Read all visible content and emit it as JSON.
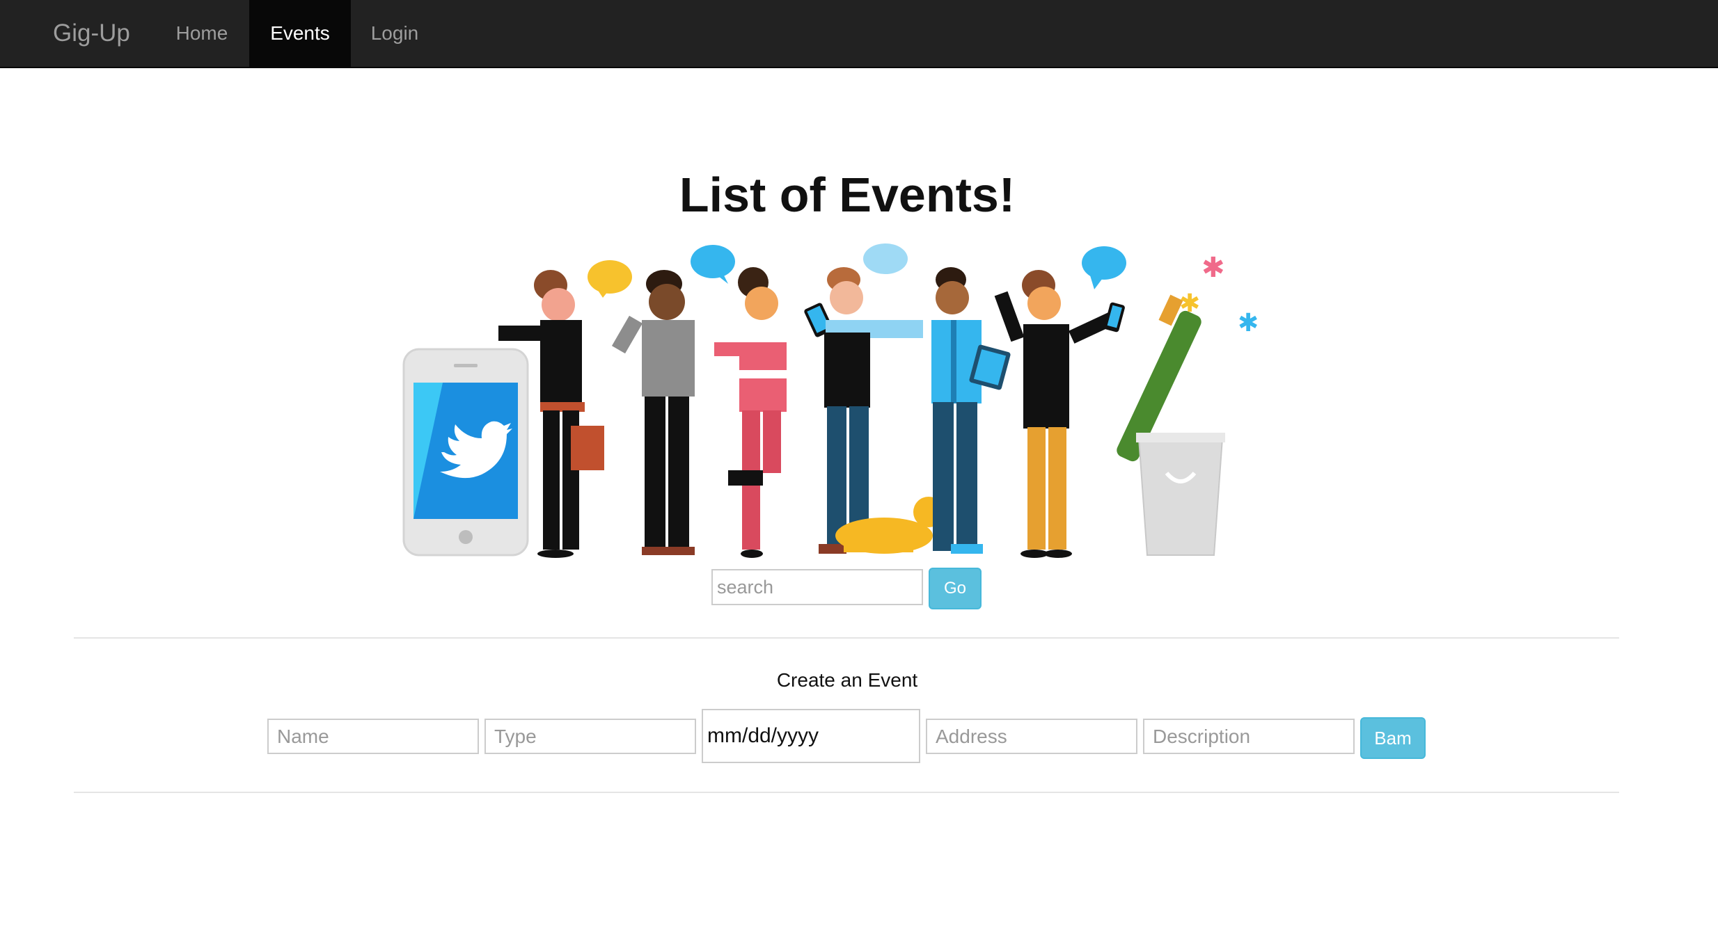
{
  "navbar": {
    "brand": "Gig-Up",
    "items": [
      {
        "label": "Home",
        "active": false
      },
      {
        "label": "Events",
        "active": true
      },
      {
        "label": "Login",
        "active": false
      }
    ]
  },
  "main": {
    "title": "List of Events!",
    "illustration_icon": "twitter-bird-icon",
    "search": {
      "placeholder": "search",
      "button_label": "Go"
    }
  },
  "create_event": {
    "title": "Create an Event",
    "fields": {
      "name_placeholder": "Name",
      "type_placeholder": "Type",
      "date_value": "mm/dd/yyyy",
      "address_placeholder": "Address",
      "description_placeholder": "Description"
    },
    "submit_label": "Bam"
  },
  "colors": {
    "navbar_bg": "#222222",
    "nav_active_bg": "#080808",
    "button_info": "#5bc0de",
    "twitter_blue": "#1da1f2"
  }
}
